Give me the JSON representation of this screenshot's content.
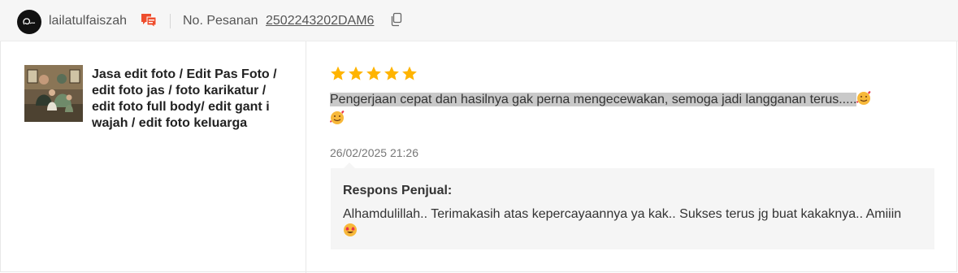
{
  "header": {
    "username": "lailatulfaiszah",
    "order_label": "No. Pesanan",
    "order_number": "2502243202DAM6"
  },
  "product": {
    "name": "Jasa edit foto / Edit Pas Foto / edit foto jas / foto karikatur / edit foto full body/ edit gant i wajah / edit foto keluarga"
  },
  "review": {
    "rating": 5,
    "max_rating": 5,
    "text": "Pengerjaan cepat dan hasilnya gak perna mengecewakan, semoga jadi langganan terus.....",
    "timestamp": "26/02/2025 21:26"
  },
  "seller_response": {
    "title": "Respons Penjual:",
    "text": "Alhamdulillah.. Terimakasih atas kepercayaannya ya kak.. Sukses terus jg buat kakaknya.. Amiiin"
  },
  "colors": {
    "star": "#ffb400",
    "chat_icon": "#ee4d2d",
    "header_bg": "#f6f6f6",
    "response_bg": "#f5f5f5",
    "highlight": "#c9c9c9"
  }
}
